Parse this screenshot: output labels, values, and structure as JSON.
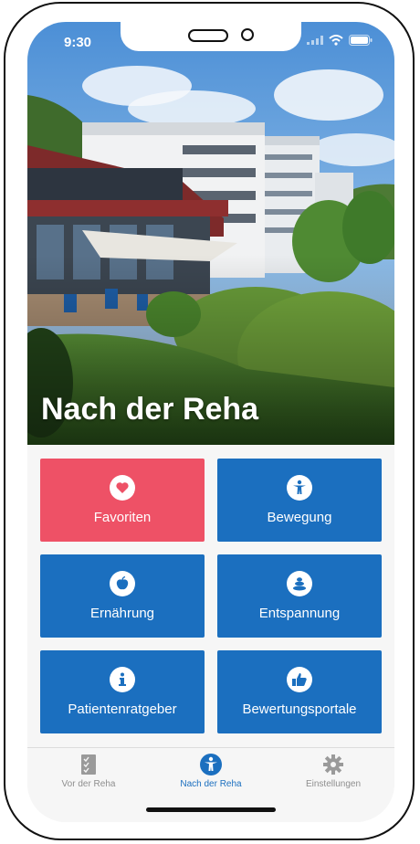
{
  "status_bar": {
    "time": "9:30"
  },
  "hero": {
    "title": "Nach der Reha"
  },
  "tiles": [
    {
      "label": "Favoriten",
      "icon": "heart-icon",
      "color": "#ee5166"
    },
    {
      "label": "Bewegung",
      "icon": "figure-icon",
      "color": "#1b6fbf"
    },
    {
      "label": "Ernährung",
      "icon": "apple-icon",
      "color": "#1b6fbf"
    },
    {
      "label": "Entspannung",
      "icon": "stones-icon",
      "color": "#1b6fbf"
    },
    {
      "label": "Patientenratgeber",
      "icon": "info-icon",
      "color": "#1b6fbf"
    },
    {
      "label": "Bewertungsportale",
      "icon": "thumbs-up-icon",
      "color": "#1b6fbf"
    }
  ],
  "tabbar": {
    "items": [
      {
        "label": "Vor der Reha",
        "icon": "checklist-icon",
        "active": false
      },
      {
        "label": "Nach der Reha",
        "icon": "figure-icon",
        "active": true
      },
      {
        "label": "Einstellungen",
        "icon": "gear-icon",
        "active": false
      }
    ]
  },
  "colors": {
    "accent": "#1b6fbf",
    "favorite": "#ee5166",
    "inactive": "#8e8e8e"
  }
}
